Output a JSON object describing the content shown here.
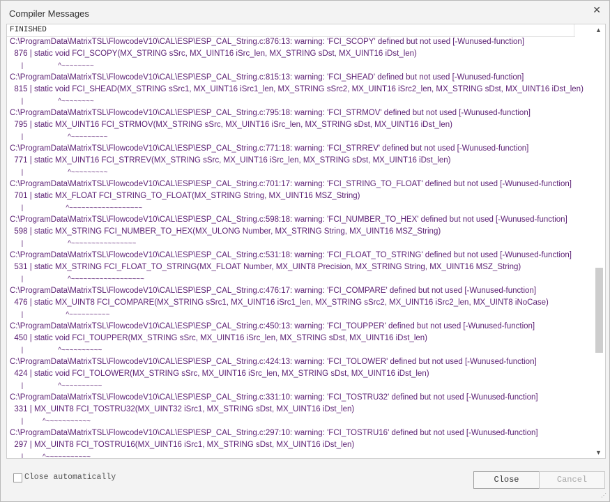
{
  "window": {
    "title": "Compiler Messages",
    "close_glyph": "✕"
  },
  "messages": {
    "header": "FINISHED",
    "lines": [
      "C:\\ProgramData\\MatrixTSL\\FlowcodeV10\\CAL\\ESP\\ESP_CAL_String.c:876:13: warning: 'FCI_SCOPY' defined but not used [-Wunused-function]",
      "  876 | static void FCI_SCOPY(MX_STRING sSrc, MX_UINT16 iSrc_len, MX_STRING sDst, MX_UINT16 iDst_len)",
      "      |                  ^~~~~~~~~",
      "C:\\ProgramData\\MatrixTSL\\FlowcodeV10\\CAL\\ESP\\ESP_CAL_String.c:815:13: warning: 'FCI_SHEAD' defined but not used [-Wunused-function]",
      "  815 | static void FCI_SHEAD(MX_STRING sSrc1, MX_UINT16 iSrc1_len, MX_STRING sSrc2, MX_UINT16 iSrc2_len, MX_STRING sDst, MX_UINT16 iDst_len)",
      "      |                  ^~~~~~~~~",
      "C:\\ProgramData\\MatrixTSL\\FlowcodeV10\\CAL\\ESP\\ESP_CAL_String.c:795:18: warning: 'FCI_STRMOV' defined but not used [-Wunused-function]",
      "  795 | static MX_UINT16 FCI_STRMOV(MX_STRING sSrc, MX_UINT16 iSrc_len, MX_STRING sDst, MX_UINT16 iDst_len)",
      "      |                       ^~~~~~~~~~",
      "C:\\ProgramData\\MatrixTSL\\FlowcodeV10\\CAL\\ESP\\ESP_CAL_String.c:771:18: warning: 'FCI_STRREV' defined but not used [-Wunused-function]",
      "  771 | static MX_UINT16 FCI_STRREV(MX_STRING sSrc, MX_UINT16 iSrc_len, MX_STRING sDst, MX_UINT16 iDst_len)",
      "      |                       ^~~~~~~~~~",
      "C:\\ProgramData\\MatrixTSL\\FlowcodeV10\\CAL\\ESP\\ESP_CAL_String.c:701:17: warning: 'FCI_STRING_TO_FLOAT' defined but not used [-Wunused-function]",
      "  701 | static MX_FLOAT FCI_STRING_TO_FLOAT(MX_STRING String, MX_UINT16 MSZ_String)",
      "      |                      ^~~~~~~~~~~~~~~~~~~",
      "C:\\ProgramData\\MatrixTSL\\FlowcodeV10\\CAL\\ESP\\ESP_CAL_String.c:598:18: warning: 'FCI_NUMBER_TO_HEX' defined but not used [-Wunused-function]",
      "  598 | static MX_STRING FCI_NUMBER_TO_HEX(MX_ULONG Number, MX_STRING String, MX_UINT16 MSZ_String)",
      "      |                       ^~~~~~~~~~~~~~~~~",
      "C:\\ProgramData\\MatrixTSL\\FlowcodeV10\\CAL\\ESP\\ESP_CAL_String.c:531:18: warning: 'FCI_FLOAT_TO_STRING' defined but not used [-Wunused-function]",
      "  531 | static MX_STRING FCI_FLOAT_TO_STRING(MX_FLOAT Number, MX_UINT8 Precision, MX_STRING String, MX_UINT16 MSZ_String)",
      "      |                       ^~~~~~~~~~~~~~~~~~~",
      "C:\\ProgramData\\MatrixTSL\\FlowcodeV10\\CAL\\ESP\\ESP_CAL_String.c:476:17: warning: 'FCI_COMPARE' defined but not used [-Wunused-function]",
      "  476 | static MX_UINT8 FCI_COMPARE(MX_STRING sSrc1, MX_UINT16 iSrc1_len, MX_STRING sSrc2, MX_UINT16 iSrc2_len, MX_UINT8 iNoCase)",
      "      |                      ^~~~~~~~~~~",
      "C:\\ProgramData\\MatrixTSL\\FlowcodeV10\\CAL\\ESP\\ESP_CAL_String.c:450:13: warning: 'FCI_TOUPPER' defined but not used [-Wunused-function]",
      "  450 | static void FCI_TOUPPER(MX_STRING sSrc, MX_UINT16 iSrc_len, MX_STRING sDst, MX_UINT16 iDst_len)",
      "      |                  ^~~~~~~~~~~",
      "C:\\ProgramData\\MatrixTSL\\FlowcodeV10\\CAL\\ESP\\ESP_CAL_String.c:424:13: warning: 'FCI_TOLOWER' defined but not used [-Wunused-function]",
      "  424 | static void FCI_TOLOWER(MX_STRING sSrc, MX_UINT16 iSrc_len, MX_STRING sDst, MX_UINT16 iDst_len)",
      "      |                  ^~~~~~~~~~~",
      "C:\\ProgramData\\MatrixTSL\\FlowcodeV10\\CAL\\ESP\\ESP_CAL_String.c:331:10: warning: 'FCI_TOSTRU32' defined but not used [-Wunused-function]",
      "  331 | MX_UINT8 FCI_TOSTRU32(MX_UINT32 iSrc1, MX_STRING sDst, MX_UINT16 iDst_len)",
      "      |          ^~~~~~~~~~~~",
      "C:\\ProgramData\\MatrixTSL\\FlowcodeV10\\CAL\\ESP\\ESP_CAL_String.c:297:10: warning: 'FCI_TOSTRU16' defined but not used [-Wunused-function]",
      "  297 | MX_UINT8 FCI_TOSTRU16(MX_UINT16 iSrc1, MX_STRING sDst, MX_UINT16 iDst_len)",
      "      |          ^~~~~~~~~~~~"
    ]
  },
  "footer": {
    "checkbox_label": "Close automatically",
    "close_label": "Close",
    "cancel_label": "Cancel"
  },
  "colors": {
    "message_text": "#5b1f73",
    "background": "#f3f3f3"
  }
}
